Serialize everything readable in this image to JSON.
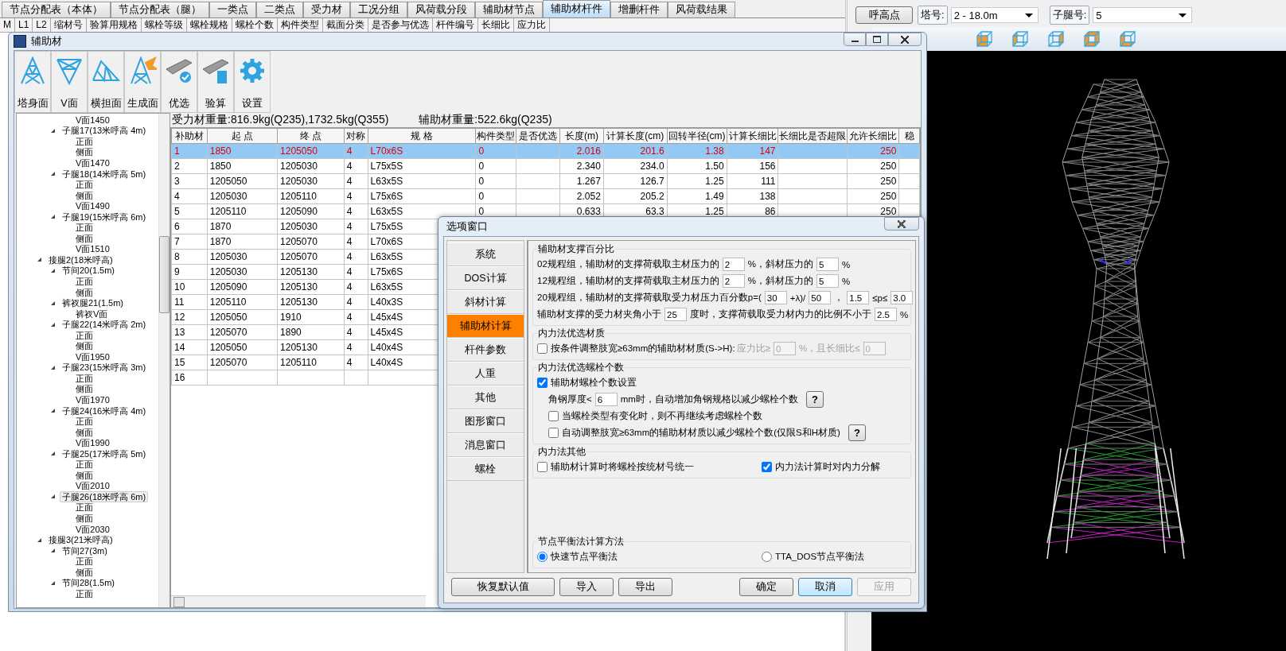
{
  "background_tabs": [
    {
      "label": "节点分配表（本体）",
      "selected": false
    },
    {
      "label": "节点分配表（腿）",
      "selected": false
    },
    {
      "label": "一类点",
      "selected": false
    },
    {
      "label": "二类点",
      "selected": false
    },
    {
      "label": "受力材",
      "selected": false
    },
    {
      "label": "工况分组",
      "selected": false
    },
    {
      "label": "风荷载分段",
      "selected": false
    },
    {
      "label": "辅助材节点",
      "selected": false
    },
    {
      "label": "辅助材杆件",
      "selected": true
    },
    {
      "label": "增删杆件",
      "selected": false
    },
    {
      "label": "风荷载结果",
      "selected": false
    }
  ],
  "background_columns": [
    "M",
    "L1",
    "L2",
    "缩材号",
    "验算用规格",
    "螺栓等级",
    "螺栓规格",
    "螺栓个数",
    "构件类型",
    "截面分类",
    "是否参与优选",
    "杆件编号",
    "长细比",
    "应力比"
  ],
  "tower_panel": {
    "button": "呼高点",
    "tower_label": "塔号:",
    "tower_value": "2 - 18.0m",
    "leg_label": "子腿号:",
    "leg_value": "5"
  },
  "aux_window": {
    "title": "辅助材",
    "toolbar": [
      {
        "label": "塔身面",
        "kind": "tower"
      },
      {
        "label": "V面",
        "kind": "v"
      },
      {
        "label": "横担面",
        "kind": "crossarm"
      },
      {
        "label": "生成面",
        "kind": "generate"
      },
      {
        "label": "优选",
        "kind": "optimize"
      },
      {
        "label": "验算",
        "kind": "check"
      },
      {
        "label": "设置",
        "kind": "settings"
      }
    ],
    "tree": [
      {
        "children": [
          {
            "children": [
              {
                "label": "V面1450",
                "selected": false
              }
            ]
          },
          {
            "label": "子腿17(13米呼高 4m)",
            "selected": false,
            "expanded": true,
            "children": [
              {
                "label": "正面",
                "selected": false
              },
              {
                "label": "侧面",
                "selected": false
              },
              {
                "label": "V面1470",
                "selected": false
              }
            ]
          },
          {
            "label": "子腿18(14米呼高 5m)",
            "selected": false,
            "expanded": true,
            "children": [
              {
                "label": "正面",
                "selected": false
              },
              {
                "label": "侧面",
                "selected": false
              },
              {
                "label": "V面1490",
                "selected": false
              }
            ]
          },
          {
            "label": "子腿19(15米呼高 6m)",
            "selected": false,
            "expanded": true,
            "children": [
              {
                "label": "正面",
                "selected": false
              },
              {
                "label": "侧面",
                "selected": false
              },
              {
                "label": "V面1510",
                "selected": false
              }
            ]
          }
        ]
      },
      {
        "label": "接腿2(18米呼高)",
        "selected": false,
        "expanded": true,
        "children": [
          {
            "label": "节间20(1.5m)",
            "selected": false,
            "expanded": true,
            "children": [
              {
                "label": "正面",
                "selected": false
              },
              {
                "label": "侧面",
                "selected": false
              }
            ]
          },
          {
            "label": "裤衩腿21(1.5m)",
            "selected": false,
            "expanded": true,
            "children": [
              {
                "label": "裤衩V面",
                "selected": false
              }
            ]
          },
          {
            "label": "子腿22(14米呼高 2m)",
            "selected": false,
            "expanded": true,
            "children": [
              {
                "label": "正面",
                "selected": false
              },
              {
                "label": "侧面",
                "selected": false
              },
              {
                "label": "V面1950",
                "selected": false
              }
            ]
          },
          {
            "label": "子腿23(15米呼高 3m)",
            "selected": false,
            "expanded": true,
            "children": [
              {
                "label": "正面",
                "selected": false
              },
              {
                "label": "侧面",
                "selected": false
              },
              {
                "label": "V面1970",
                "selected": false
              }
            ]
          },
          {
            "label": "子腿24(16米呼高 4m)",
            "selected": false,
            "expanded": true,
            "children": [
              {
                "label": "正面",
                "selected": false
              },
              {
                "label": "侧面",
                "selected": false
              },
              {
                "label": "V面1990",
                "selected": false
              }
            ]
          },
          {
            "label": "子腿25(17米呼高 5m)",
            "selected": false,
            "expanded": true,
            "children": [
              {
                "label": "正面",
                "selected": false
              },
              {
                "label": "侧面",
                "selected": false
              },
              {
                "label": "V面2010",
                "selected": false
              }
            ]
          },
          {
            "label": "子腿26(18米呼高 6m)",
            "selected": true,
            "expanded": true,
            "children": [
              {
                "label": "正面",
                "selected": false
              },
              {
                "label": "侧面",
                "selected": false
              },
              {
                "label": "V面2030",
                "selected": false
              }
            ]
          }
        ]
      },
      {
        "label": "接腿3(21米呼高)",
        "selected": false,
        "expanded": true,
        "children": [
          {
            "label": "节间27(3m)",
            "selected": false,
            "expanded": true,
            "children": [
              {
                "label": "正面",
                "selected": false
              },
              {
                "label": "侧面",
                "selected": false
              }
            ]
          },
          {
            "label": "节间28(1.5m)",
            "selected": false,
            "expanded": true,
            "children": [
              {
                "label": "正面",
                "selected": false
              }
            ]
          }
        ]
      }
    ],
    "weight_main": "受力材重量:816.9kg(Q235),1732.5kg(Q355)",
    "weight_aux": "辅助材重量:522.6kg(Q235)",
    "table": {
      "columns": [
        {
          "label": "补助材",
          "kind": "text"
        },
        {
          "label": "起 点",
          "kind": "text"
        },
        {
          "label": "终 点",
          "kind": "text"
        },
        {
          "label": "对称",
          "kind": "text"
        },
        {
          "label": "规 格",
          "kind": "text"
        },
        {
          "label": "构件类型",
          "kind": "text"
        },
        {
          "label": "是否优选",
          "kind": "text"
        },
        {
          "label": "长度(m)",
          "kind": "number"
        },
        {
          "label": "计算长度(cm)",
          "kind": "number"
        },
        {
          "label": "回转半径(cm)",
          "kind": "number"
        },
        {
          "label": "计算长细比",
          "kind": "number"
        },
        {
          "label": "长细比是否超限",
          "kind": "text"
        },
        {
          "label": "允许长细比",
          "kind": "number"
        },
        {
          "label": "稳",
          "kind": "text"
        }
      ],
      "rows": [
        {
          "selected": true,
          "cells": [
            "1",
            "1850",
            "1205050",
            "4",
            "L70x6S",
            "0",
            null,
            "2.016",
            "201.6",
            "1.38",
            "147",
            null,
            "250"
          ]
        },
        {
          "selected": false,
          "cells": [
            "2",
            "1850",
            "1205030",
            "4",
            "L75x5S",
            "0",
            null,
            "2.340",
            "234.0",
            "1.50",
            "156",
            null,
            "250"
          ]
        },
        {
          "selected": false,
          "cells": [
            "3",
            "1205050",
            "1205030",
            "4",
            "L63x5S",
            "0",
            null,
            "1.267",
            "126.7",
            "1.25",
            "111",
            null,
            "250"
          ]
        },
        {
          "selected": false,
          "cells": [
            "4",
            "1205030",
            "1205110",
            "4",
            "L75x6S",
            "0",
            null,
            "2.052",
            "205.2",
            "1.49",
            "138",
            null,
            "250"
          ]
        },
        {
          "selected": false,
          "cells": [
            "5",
            "1205110",
            "1205090",
            "4",
            "L63x5S",
            "0",
            null,
            "0.633",
            "63.3",
            "1.25",
            "86",
            null,
            "250"
          ]
        },
        {
          "selected": false,
          "cells": [
            "6",
            "1870",
            "1205030",
            "4",
            "L75x5S"
          ]
        },
        {
          "selected": false,
          "cells": [
            "7",
            "1870",
            "1205070",
            "4",
            "L70x6S"
          ]
        },
        {
          "selected": false,
          "cells": [
            "8",
            "1205030",
            "1205070",
            "4",
            "L63x5S"
          ]
        },
        {
          "selected": false,
          "cells": [
            "9",
            "1205030",
            "1205130",
            "4",
            "L75x6S"
          ]
        },
        {
          "selected": false,
          "cells": [
            "10",
            "1205090",
            "1205130",
            "4",
            "L63x5S"
          ]
        },
        {
          "selected": false,
          "cells": [
            "11",
            "1205110",
            "1205130",
            "4",
            "L40x3S"
          ]
        },
        {
          "selected": false,
          "cells": [
            "12",
            "1205050",
            "1910",
            "4",
            "L45x4S"
          ]
        },
        {
          "selected": false,
          "cells": [
            "13",
            "1205070",
            "1890",
            "4",
            "L45x4S"
          ]
        },
        {
          "selected": false,
          "cells": [
            "14",
            "1205050",
            "1205130",
            "4",
            "L40x4S"
          ]
        },
        {
          "selected": false,
          "cells": [
            "15",
            "1205070",
            "1205110",
            "4",
            "L40x4S"
          ]
        },
        {
          "selected": false,
          "cells": [
            "16"
          ]
        }
      ]
    }
  },
  "options_dialog": {
    "title": "选项窗口",
    "nav": [
      {
        "label": "系统",
        "selected": false
      },
      {
        "label": "DOS计算",
        "selected": false
      },
      {
        "label": "斜材计算",
        "selected": false
      },
      {
        "label": "辅助材计算",
        "selected": true
      },
      {
        "label": "杆件参数",
        "selected": false
      },
      {
        "label": "人重",
        "selected": false
      },
      {
        "label": "其他",
        "selected": false
      },
      {
        "label": "图形窗口",
        "selected": false
      },
      {
        "label": "消息窗口",
        "selected": false
      },
      {
        "label": "螺栓",
        "selected": false
      }
    ],
    "groups": [
      {
        "title": "辅助材支撑百分比",
        "rows": [
          {
            "parts": [
              {
                "kind": "text",
                "text": "02规程组，辅助材的支撑荷载取主材压力的"
              },
              {
                "kind": "field",
                "value": "2"
              },
              {
                "kind": "text",
                "text": "%，斜材压力的"
              },
              {
                "kind": "field",
                "value": "5"
              },
              {
                "kind": "text",
                "text": "%"
              }
            ]
          },
          {
            "parts": [
              {
                "kind": "text",
                "text": "12规程组，辅助材的支撑荷载取主材压力的"
              },
              {
                "kind": "field",
                "value": "2"
              },
              {
                "kind": "text",
                "text": "%，斜材压力的"
              },
              {
                "kind": "field",
                "value": "5"
              },
              {
                "kind": "text",
                "text": "%"
              }
            ]
          },
          {
            "parts": [
              {
                "kind": "text",
                "text": "20规程组，辅助材的支撑荷载取受力材压力百分数p=("
              },
              {
                "kind": "field",
                "value": "30"
              },
              {
                "kind": "text",
                "text": "+λ)/"
              },
              {
                "kind": "field",
                "value": "50"
              },
              {
                "kind": "text",
                "text": "，"
              },
              {
                "kind": "field",
                "value": "1.5"
              },
              {
                "kind": "text",
                "text": "≤p≤"
              },
              {
                "kind": "field",
                "value": "3.0"
              }
            ]
          },
          {
            "parts": [
              {
                "kind": "text",
                "text": "辅助材支撑的受力材夹角小于"
              },
              {
                "kind": "field",
                "value": "25"
              },
              {
                "kind": "text",
                "text": "度时，支撑荷载取受力材内力的比例不小于"
              },
              {
                "kind": "field",
                "value": "2.5"
              },
              {
                "kind": "text",
                "text": "%"
              }
            ]
          }
        ]
      },
      {
        "title": "内力法优选材质",
        "rows": [
          {
            "parts": [
              {
                "kind": "check",
                "text": "按条件调整肢宽≥63mm的辅助材材质(S->H):",
                "checked": false,
                "disabled": false
              },
              {
                "kind": "text",
                "text": "应力比≥",
                "disabled": true
              },
              {
                "kind": "field",
                "value": "0",
                "disabled": true
              },
              {
                "kind": "text",
                "text": "%，且长细比≤",
                "disabled": true
              },
              {
                "kind": "field",
                "value": "0",
                "disabled": true
              }
            ]
          }
        ]
      },
      {
        "title": "内力法优选螺栓个数",
        "rows": [
          {
            "parts": [
              {
                "kind": "check",
                "text": "辅助材螺栓个数设置",
                "checked": true
              }
            ]
          },
          {
            "indent": true,
            "parts": [
              {
                "kind": "text",
                "text": "角钢厚度<"
              },
              {
                "kind": "field",
                "value": "6"
              },
              {
                "kind": "text",
                "text": "mm时，自动增加角钢规格以减少螺栓个数"
              },
              {
                "kind": "help",
                "text": "?"
              }
            ]
          },
          {
            "indent": true,
            "parts": [
              {
                "kind": "check",
                "text": "当螺栓类型有变化时，则不再继续考虑螺栓个数",
                "checked": false
              }
            ]
          },
          {
            "indent": true,
            "parts": [
              {
                "kind": "check",
                "text": "自动调整肢宽≥63mm的辅助材材质以减少螺栓个数(仅限S和H材质)",
                "checked": false
              },
              {
                "kind": "help",
                "text": "?"
              }
            ]
          }
        ]
      },
      {
        "title": "内力法其他",
        "rows": [
          {
            "parts": [
              {
                "kind": "check",
                "text": "辅助材计算时将螺栓按统材号统一",
                "checked": false
              },
              {
                "kind": "check",
                "text": "内力法计算时对内力分解",
                "checked": true
              }
            ]
          }
        ]
      },
      {
        "title": "节点平衡法计算方法",
        "rows": [
          {
            "parts": [
              {
                "kind": "radio",
                "text": "快速节点平衡法",
                "selected": true
              },
              {
                "kind": "radio",
                "text": "TTA_DOS节点平衡法",
                "selected": false
              }
            ]
          }
        ]
      }
    ],
    "left_buttons": [
      {
        "label": "恢复默认值",
        "focused": false,
        "disabled": false
      },
      {
        "label": "导入",
        "focused": false,
        "disabled": false
      },
      {
        "label": "导出",
        "focused": false,
        "disabled": false
      }
    ],
    "right_buttons": [
      {
        "label": "确定",
        "focused": false,
        "disabled": false
      },
      {
        "label": "取消",
        "focused": true,
        "disabled": false
      },
      {
        "label": "应用",
        "focused": false,
        "disabled": true
      }
    ]
  }
}
